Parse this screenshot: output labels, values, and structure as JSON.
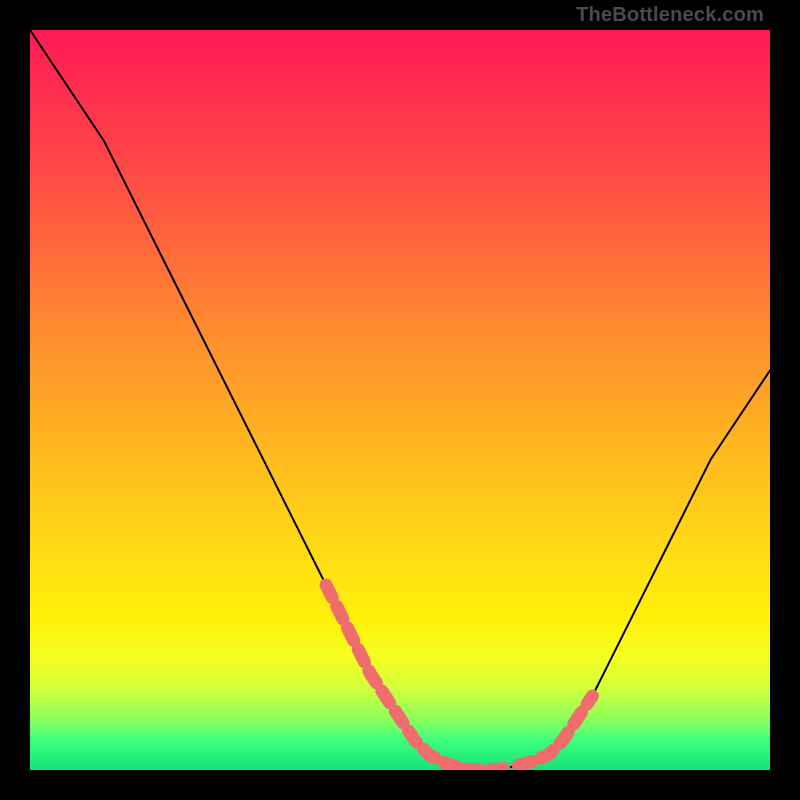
{
  "watermark": "TheBottleneck.com",
  "chart_data": {
    "type": "line",
    "title": "",
    "xlabel": "",
    "ylabel": "",
    "xlim": [
      0,
      100
    ],
    "ylim": [
      0,
      100
    ],
    "series": [
      {
        "name": "curve",
        "x": [
          0,
          2,
          4,
          6,
          8,
          10,
          12,
          14,
          16,
          18,
          20,
          22,
          24,
          26,
          28,
          30,
          32,
          34,
          36,
          38,
          40,
          42,
          44,
          46,
          48,
          50,
          52,
          54,
          56,
          58,
          60,
          62,
          64,
          66,
          68,
          70,
          72,
          74,
          76,
          78,
          80,
          82,
          84,
          86,
          88,
          90,
          92,
          94,
          96,
          98,
          100
        ],
        "y": [
          100,
          97,
          94,
          91,
          88,
          85,
          81,
          77,
          73,
          69,
          65,
          61,
          57,
          53,
          49,
          45,
          41,
          37,
          33,
          29,
          25,
          21,
          17,
          13,
          10,
          7,
          4,
          2,
          1,
          0.3,
          0,
          0,
          0.2,
          0.6,
          1.2,
          2,
          4,
          7,
          10,
          14,
          18,
          22,
          26,
          30,
          34,
          38,
          42,
          45,
          48,
          51,
          54
        ]
      }
    ],
    "highlights": {
      "name": "dotted-band",
      "color": "#f06d6d",
      "segments": [
        {
          "x": [
            40,
            42,
            44,
            46,
            48,
            50,
            52,
            54,
            56,
            58,
            60,
            62,
            64
          ],
          "y": [
            25,
            21,
            17,
            13,
            10,
            7,
            4,
            2,
            1,
            0.3,
            0,
            0,
            0.2
          ]
        },
        {
          "x": [
            66,
            68,
            70,
            72,
            74,
            76
          ],
          "y": [
            0.6,
            1.2,
            2,
            4,
            7,
            10
          ]
        }
      ]
    },
    "gradient_stops": [
      {
        "pos": 0.0,
        "color": "#ff1a55"
      },
      {
        "pos": 0.18,
        "color": "#ff4747"
      },
      {
        "pos": 0.42,
        "color": "#ff8f2e"
      },
      {
        "pos": 0.68,
        "color": "#ffd516"
      },
      {
        "pos": 0.85,
        "color": "#f4ff22"
      },
      {
        "pos": 1.0,
        "color": "#14e27a"
      }
    ]
  }
}
